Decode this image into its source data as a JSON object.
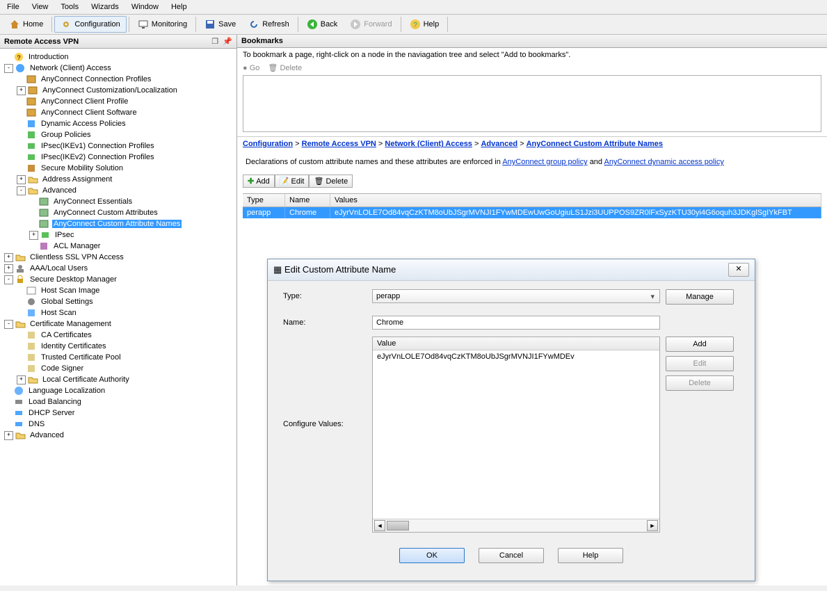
{
  "menu": {
    "file": "File",
    "view": "View",
    "tools": "Tools",
    "wizards": "Wizards",
    "window": "Window",
    "help": "Help"
  },
  "toolbar": {
    "home": "Home",
    "configuration": "Configuration",
    "monitoring": "Monitoring",
    "save": "Save",
    "refresh": "Refresh",
    "back": "Back",
    "forward": "Forward",
    "help": "Help"
  },
  "leftPane": {
    "title": "Remote Access VPN",
    "nodes": [
      {
        "icon": "question",
        "label": "Introduction"
      },
      {
        "icon": "globe",
        "label": "Network (Client) Access",
        "expander": "-"
      },
      {
        "icon": "ac",
        "indent": 1,
        "label": "AnyConnect Connection Profiles"
      },
      {
        "icon": "ac",
        "indent": 1,
        "label": "AnyConnect Customization/Localization",
        "expander": "+"
      },
      {
        "icon": "ac",
        "indent": 1,
        "label": "AnyConnect Client Profile"
      },
      {
        "icon": "ac",
        "indent": 1,
        "label": "AnyConnect Client Software"
      },
      {
        "icon": "dap",
        "indent": 1,
        "label": "Dynamic Access Policies"
      },
      {
        "icon": "gp",
        "indent": 1,
        "label": "Group Policies"
      },
      {
        "icon": "ipsec",
        "indent": 1,
        "label": "IPsec(IKEv1) Connection Profiles"
      },
      {
        "icon": "ipsec",
        "indent": 1,
        "label": "IPsec(IKEv2) Connection Profiles"
      },
      {
        "icon": "sms",
        "indent": 1,
        "label": "Secure Mobility Solution"
      },
      {
        "icon": "folder",
        "indent": 1,
        "label": "Address Assignment",
        "expander": "+"
      },
      {
        "icon": "folder",
        "indent": 1,
        "label": "Advanced",
        "expander": "-"
      },
      {
        "icon": "attr",
        "indent": 2,
        "label": "AnyConnect Essentials"
      },
      {
        "icon": "attr",
        "indent": 2,
        "label": "AnyConnect Custom Attributes"
      },
      {
        "icon": "attr",
        "indent": 2,
        "label": "AnyConnect Custom Attribute Names",
        "selected": true
      },
      {
        "icon": "ipsec",
        "indent": 2,
        "label": "IPsec",
        "expander": "+"
      },
      {
        "icon": "acl",
        "indent": 2,
        "label": "ACL Manager"
      },
      {
        "icon": "folder",
        "label": "Clientless SSL VPN Access",
        "expander": "+"
      },
      {
        "icon": "users",
        "label": "AAA/Local Users",
        "expander": "+"
      },
      {
        "icon": "lock",
        "label": "Secure Desktop Manager",
        "expander": "-"
      },
      {
        "icon": "img",
        "indent": 1,
        "label": "Host Scan Image"
      },
      {
        "icon": "settings",
        "indent": 1,
        "label": "Global Settings"
      },
      {
        "icon": "scan",
        "indent": 1,
        "label": "Host Scan"
      },
      {
        "icon": "folder",
        "label": "Certificate Management",
        "expander": "-"
      },
      {
        "icon": "cert",
        "indent": 1,
        "label": "CA Certificates"
      },
      {
        "icon": "cert",
        "indent": 1,
        "label": "Identity Certificates"
      },
      {
        "icon": "cert",
        "indent": 1,
        "label": "Trusted Certificate Pool"
      },
      {
        "icon": "cert",
        "indent": 1,
        "label": "Code Signer"
      },
      {
        "icon": "folder",
        "indent": 1,
        "label": "Local Certificate Authority",
        "expander": "+"
      },
      {
        "icon": "lang",
        "label": "Language Localization"
      },
      {
        "icon": "lb",
        "label": "Load Balancing"
      },
      {
        "icon": "dhcp",
        "label": "DHCP Server"
      },
      {
        "icon": "dns",
        "label": "DNS"
      },
      {
        "icon": "folder",
        "label": "Advanced",
        "expander": "+"
      }
    ]
  },
  "rightPane": {
    "bookmarksTitle": "Bookmarks",
    "hint": "To bookmark a page, right-click on a node in the naviagation tree and select \"Add to bookmarks\".",
    "go": "Go",
    "delete": "Delete",
    "breadcrumb": {
      "configuration": "Configuration",
      "ravpn": "Remote Access VPN",
      "nca": "Network (Client) Access",
      "advanced": "Advanced",
      "current": "AnyConnect Custom Attribute Names"
    },
    "description": {
      "pre": "Declarations of custom attribute names and these attributes are enforced in ",
      "link1": "AnyConnect group policy",
      "mid": " and ",
      "link2": "AnyConnect dynamic access policy"
    },
    "actions": {
      "add": "Add",
      "edit": "Edit",
      "delete": "Delete"
    },
    "table": {
      "headers": {
        "type": "Type",
        "name": "Name",
        "values": "Values"
      },
      "row": {
        "type": "perapp",
        "name": "Chrome",
        "values": "eJyrVnLOLE7Od84vqCzKTM8oUbJSgrMVNJI1FYwMDEwUwGoUgiuLS1Jzi3UUPPOS9ZR0lFxSyzKTU30yi4G6oquh3JDKglSgIYkFBT"
      }
    }
  },
  "dialog": {
    "title": "Edit Custom Attribute Name",
    "labels": {
      "type": "Type:",
      "name": "Name:",
      "value": "Value",
      "configure": "Configure Values:"
    },
    "type_value": "perapp",
    "name_value": "Chrome",
    "value_row": "eJyrVnLOLE7Od84vqCzKTM8oUbJSgrMVNJI1FYwMDEv",
    "buttons": {
      "manage": "Manage",
      "add": "Add",
      "edit": "Edit",
      "delete": "Delete",
      "ok": "OK",
      "cancel": "Cancel",
      "help": "Help"
    }
  }
}
